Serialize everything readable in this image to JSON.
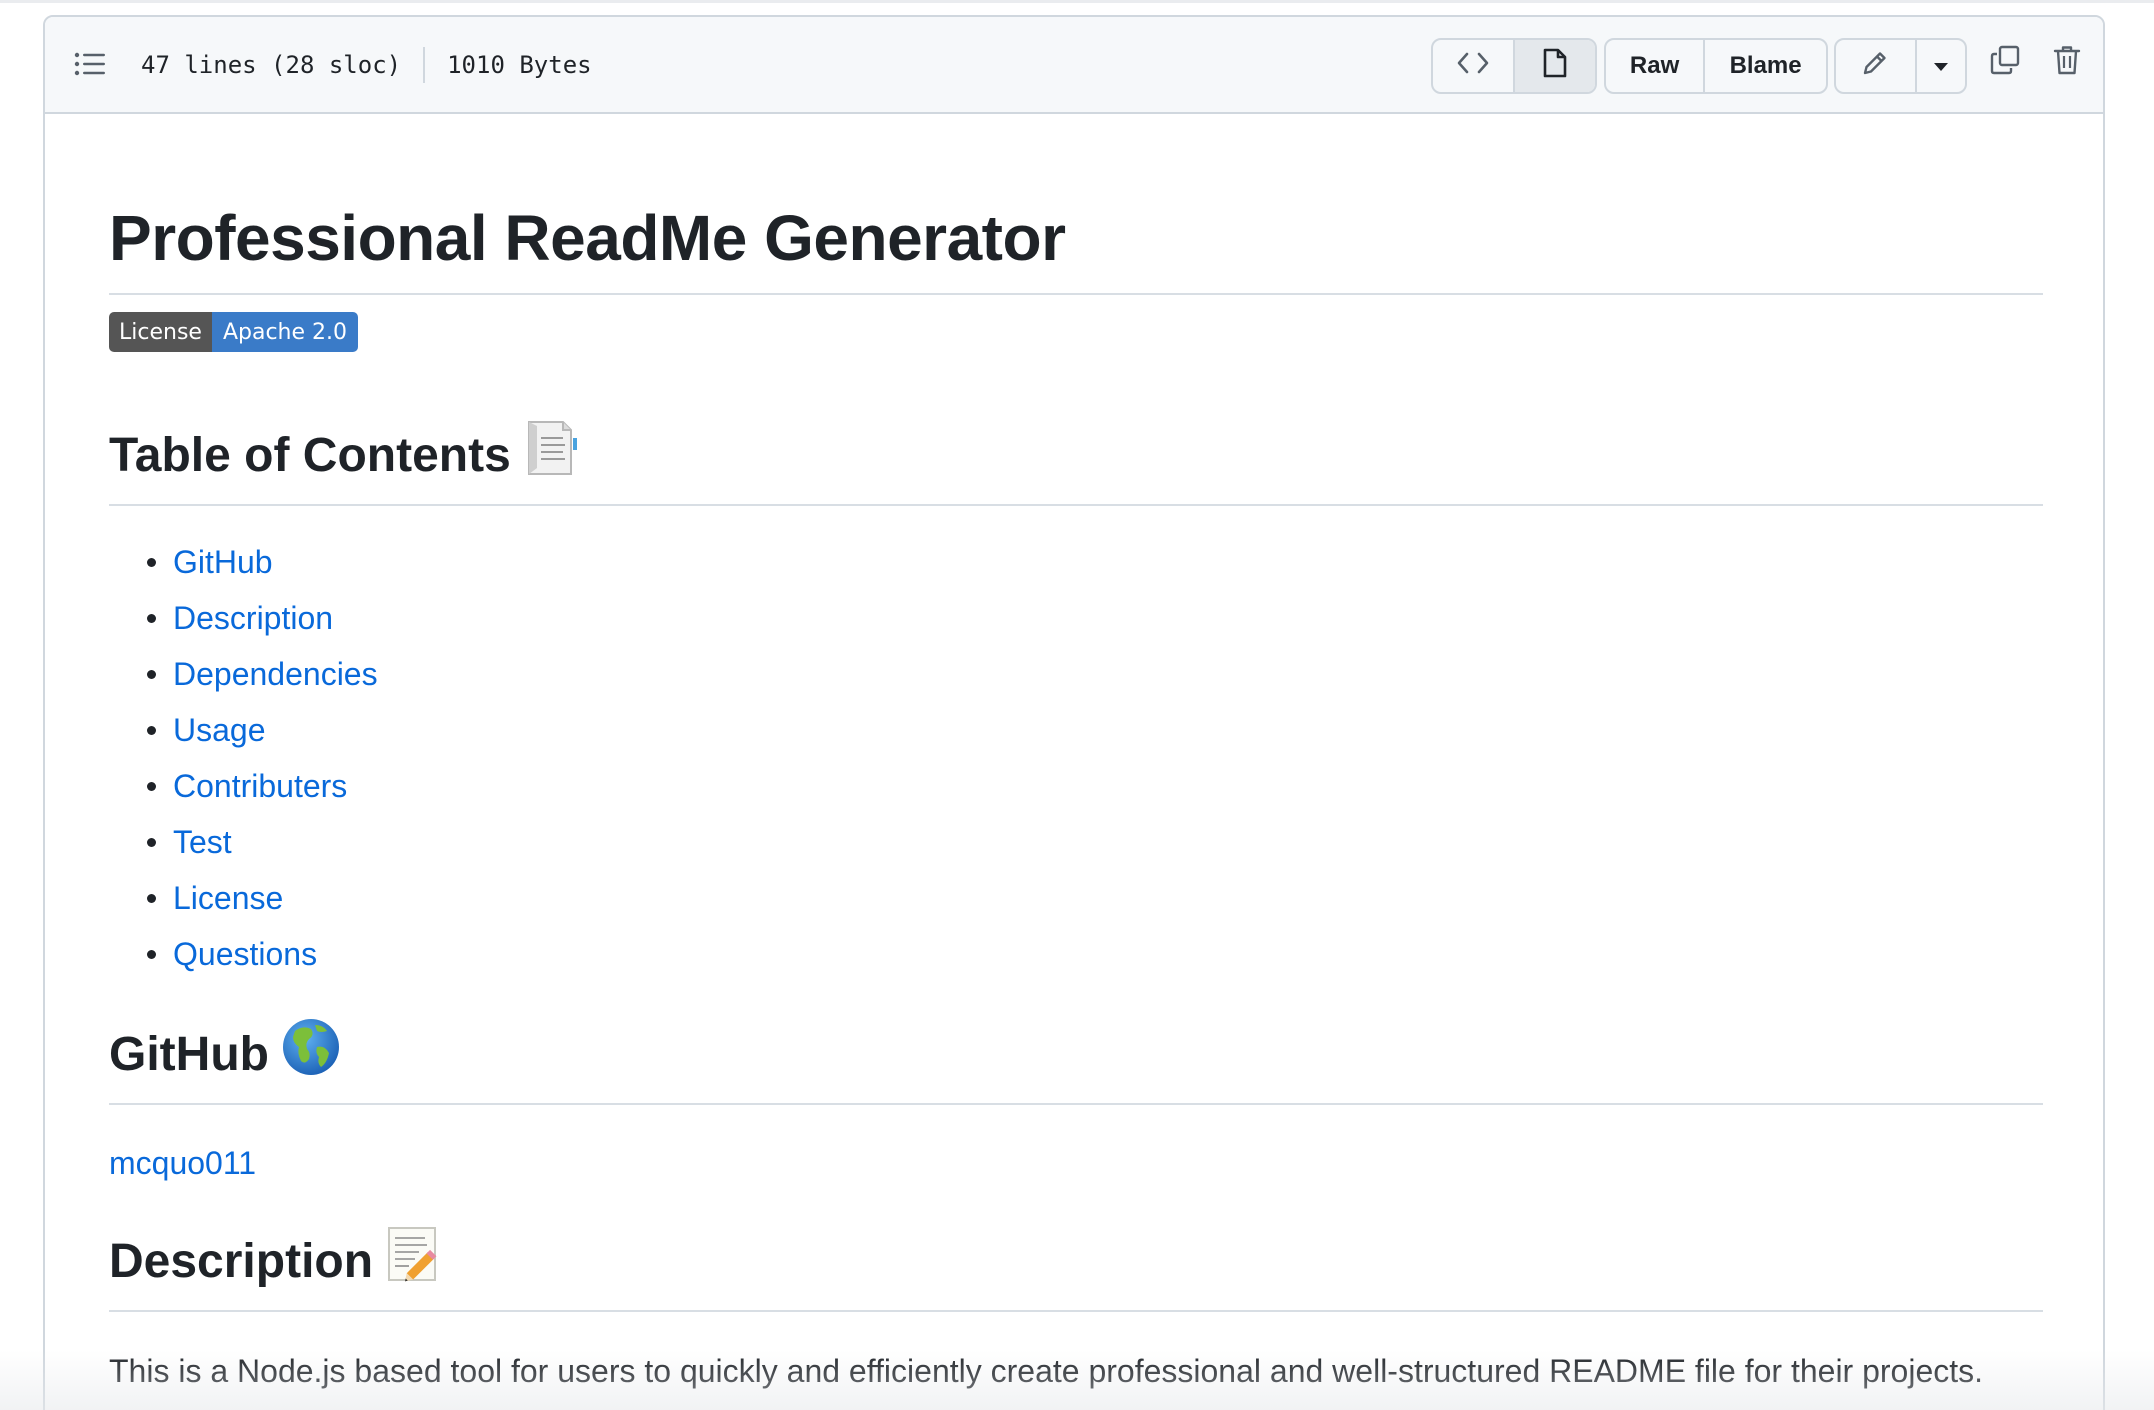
{
  "file_header": {
    "lines_info": "47 lines (28 sloc)",
    "size_info": "1010 Bytes",
    "raw_label": "Raw",
    "blame_label": "Blame",
    "icons": [
      "list-unordered-icon",
      "code-icon",
      "file-icon",
      "pencil-icon",
      "triangle-down-icon",
      "copy-icon",
      "trash-icon"
    ]
  },
  "readme": {
    "title": "Professional ReadMe Generator",
    "badge": {
      "label": "License",
      "value": "Apache 2.0",
      "label_color": "#555555",
      "value_color": "#3a7bc8"
    },
    "toc_heading": "Table of Contents",
    "toc_emoji": "page-facing-up-emoji",
    "toc_items": [
      "GitHub",
      "Description",
      "Dependencies",
      "Usage",
      "Contributers",
      "Test",
      "License",
      "Questions"
    ],
    "github_heading": "GitHub",
    "github_emoji": "globe-americas-emoji",
    "github_user": "mcquo011",
    "description_heading": "Description",
    "description_emoji": "memo-emoji",
    "description_text": "This is a Node.js based tool for users to quickly and efficiently create professional and well-structured README file for their projects."
  },
  "colors": {
    "link": "#0969da",
    "text": "#1f2328",
    "border": "#d0d7de",
    "header_bg": "#f6f8fa"
  }
}
